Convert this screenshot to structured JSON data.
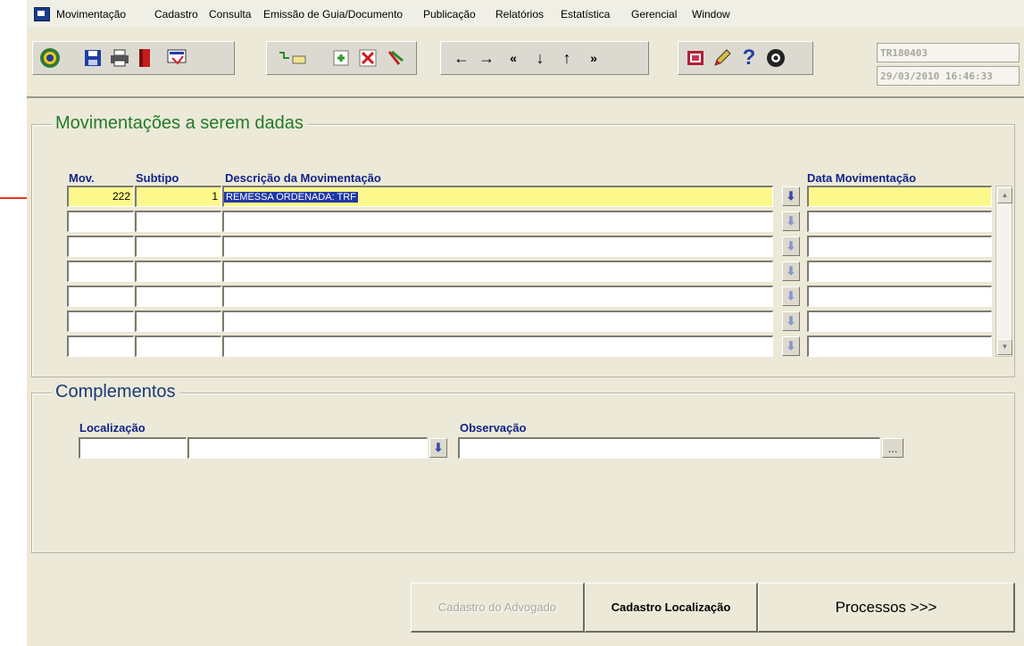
{
  "menu": {
    "items": [
      "Movimentação",
      "Cadastro",
      "Consulta",
      "Emissão de Guia/Documento",
      "Publicação",
      "Relatórios",
      "Estatística",
      "Gerencial",
      "Window"
    ]
  },
  "toolbar": {
    "icons": [
      "emblem-icon",
      "save-icon",
      "print-icon",
      "exit-icon",
      "screen-icon",
      "query-icon",
      "insert-record-icon",
      "delete-record-icon",
      "clear-icon",
      "prev-icon",
      "next-icon",
      "first-icon",
      "down-icon",
      "up-icon",
      "last-icon",
      "lov-icon",
      "edit-icon",
      "help-icon",
      "spy-icon"
    ],
    "user_code": "TR180403",
    "datetime": "29/03/2010 16:46:33"
  },
  "movimentacoes": {
    "title": "Movimentações a serem dadas",
    "headers": {
      "mov": "Mov.",
      "subtipo": "Subtipo",
      "descricao": "Descrição da Movimentação",
      "data": "Data Movimentação"
    },
    "rows": [
      {
        "mov": "222",
        "subtipo": "1",
        "descricao": "REMESSA ORDENADA: TRF",
        "data": ""
      },
      {
        "mov": "",
        "subtipo": "",
        "descricao": "",
        "data": ""
      },
      {
        "mov": "",
        "subtipo": "",
        "descricao": "",
        "data": ""
      },
      {
        "mov": "",
        "subtipo": "",
        "descricao": "",
        "data": ""
      },
      {
        "mov": "",
        "subtipo": "",
        "descricao": "",
        "data": ""
      },
      {
        "mov": "",
        "subtipo": "",
        "descricao": "",
        "data": ""
      },
      {
        "mov": "",
        "subtipo": "",
        "descricao": "",
        "data": ""
      }
    ]
  },
  "complementos": {
    "title": "Complementos",
    "localizacao_label": "Localização",
    "observacao_label": "Observação",
    "localizacao_code": "",
    "localizacao_desc": "",
    "observacao": "",
    "ellipsis": "..."
  },
  "buttons": {
    "advogado": "Cadastro do Advogado",
    "localizacao": "Cadastro Localização",
    "processos": "Processos >>>"
  },
  "colors": {
    "title_green": "#237a2a",
    "header_blue": "#11238a",
    "current_row": "#fcf88b",
    "arrow_red": "#e83522"
  }
}
